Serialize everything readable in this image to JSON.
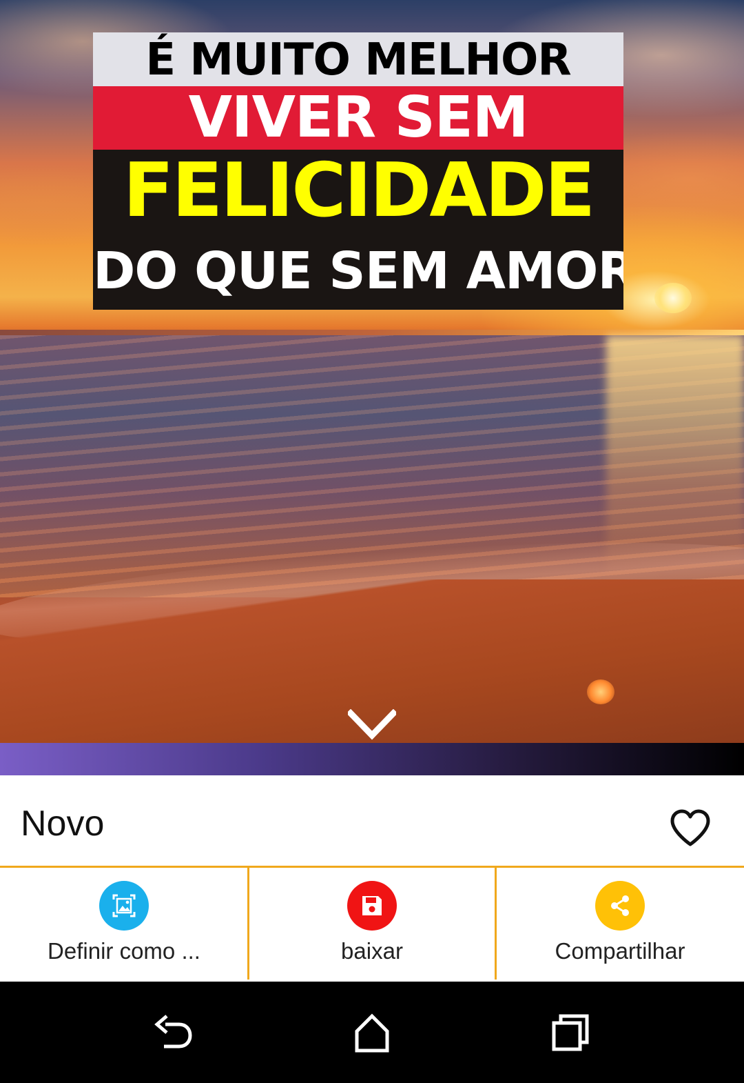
{
  "quote": {
    "line1": "É MUITO MELHOR",
    "line2": "VIVER SEM",
    "line3": "FELICIDADE",
    "line4": "DO QUE SEM AMOR"
  },
  "header": {
    "title": "Novo"
  },
  "actions": [
    {
      "label": "Definir como ...",
      "icon": "wallpaper-icon",
      "color": "#1ab0ec"
    },
    {
      "label": "baixar",
      "icon": "save-icon",
      "color": "#f01414"
    },
    {
      "label": "Compartilhar",
      "icon": "share-icon",
      "color": "#ffc107"
    }
  ],
  "colors": {
    "accent_divider": "#f0a81c",
    "gradient_start": "#7a5ec6",
    "gradient_end": "#000000"
  },
  "icons": {
    "expand": "chevron-down-icon",
    "favorite": "heart-outline-icon",
    "nav_back": "back-icon",
    "nav_home": "home-icon",
    "nav_recents": "recents-icon"
  }
}
